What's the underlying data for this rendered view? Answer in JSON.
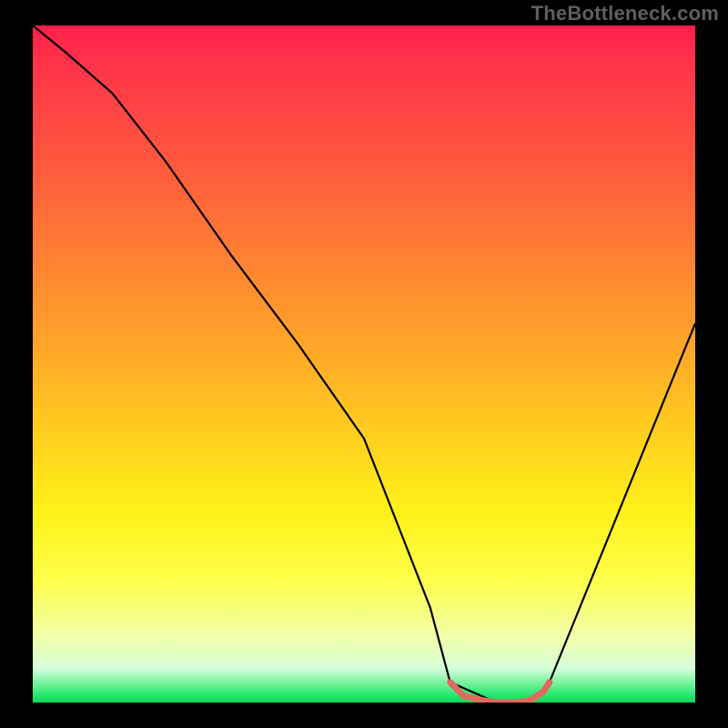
{
  "watermark": "TheBottleneck.com",
  "chart_data": {
    "type": "line",
    "title": "",
    "xlabel": "",
    "ylabel": "",
    "xlim": [
      0,
      100
    ],
    "ylim": [
      0,
      100
    ],
    "grid": false,
    "legend": false,
    "background": "red-yellow-green vertical gradient",
    "series": [
      {
        "name": "bottleneck-curve",
        "color": "#000000",
        "x": [
          0,
          5,
          12,
          20,
          30,
          40,
          50,
          60,
          63,
          70,
          75,
          78,
          100
        ],
        "y": [
          100,
          96,
          90,
          80,
          66,
          53,
          39,
          14,
          3,
          0,
          0,
          3,
          56
        ]
      },
      {
        "name": "optimal-range",
        "color": "#e2695f",
        "x": [
          63,
          65,
          68,
          70,
          73,
          75,
          77,
          78
        ],
        "y": [
          3,
          1,
          0.3,
          0,
          0,
          0.3,
          1.5,
          3
        ]
      }
    ],
    "gradient_stops": [
      {
        "pos": 0.0,
        "color": "#ff1f4a"
      },
      {
        "pos": 0.18,
        "color": "#ff5240"
      },
      {
        "pos": 0.46,
        "color": "#ffa229"
      },
      {
        "pos": 0.72,
        "color": "#fff21a"
      },
      {
        "pos": 0.9,
        "color": "#f3ffa8"
      },
      {
        "pos": 0.99,
        "color": "#22e76a"
      },
      {
        "pos": 1.0,
        "color": "#14d85c"
      }
    ]
  }
}
